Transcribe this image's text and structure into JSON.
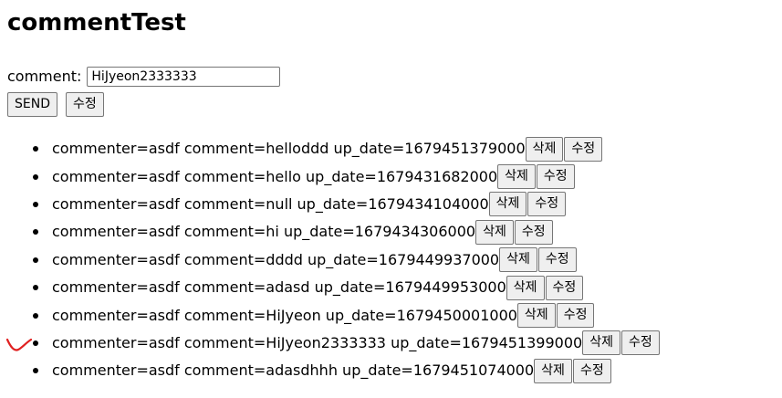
{
  "page": {
    "title": "commentTest"
  },
  "form": {
    "comment_label": "comment:",
    "comment_value": "HiJyeon2333333",
    "send_label": "SEND",
    "edit_label": "수정"
  },
  "comments": [
    {
      "text": "commenter=asdf comment=helloddd up_date=1679451379000",
      "delete_label": "삭제",
      "edit_label": "수정"
    },
    {
      "text": "commenter=asdf comment=hello up_date=1679431682000",
      "delete_label": "삭제",
      "edit_label": "수정"
    },
    {
      "text": "commenter=asdf comment=null up_date=1679434104000",
      "delete_label": "삭제",
      "edit_label": "수정"
    },
    {
      "text": "commenter=asdf comment=hi up_date=1679434306000",
      "delete_label": "삭제",
      "edit_label": "수정"
    },
    {
      "text": "commenter=asdf comment=dddd up_date=1679449937000",
      "delete_label": "삭제",
      "edit_label": "수정"
    },
    {
      "text": "commenter=asdf comment=adasd up_date=1679449953000",
      "delete_label": "삭제",
      "edit_label": "수정"
    },
    {
      "text": "commenter=asdf comment=HiJyeon up_date=1679450001000",
      "delete_label": "삭제",
      "edit_label": "수정"
    },
    {
      "text": "commenter=asdf comment=HiJyeon2333333 up_date=1679451399000",
      "delete_label": "삭제",
      "edit_label": "수정"
    },
    {
      "text": "commenter=asdf comment=adasdhhh up_date=1679451074000",
      "delete_label": "삭제",
      "edit_label": "수정"
    }
  ],
  "colors": {
    "annotation_mark": "#e02020",
    "button_background": "#efefef",
    "button_border": "#767676"
  },
  "annotation": {
    "icon": "red-check-curve-icon"
  }
}
